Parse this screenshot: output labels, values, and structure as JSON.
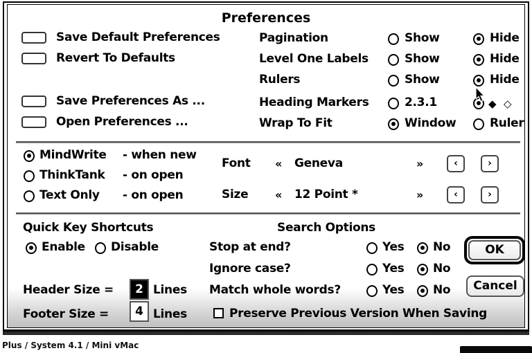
{
  "window": {
    "title": "Preferences"
  },
  "file_buttons": [
    {
      "label": "Save Default Preferences"
    },
    {
      "label": "Revert To Defaults"
    },
    {
      "label": "Save Preferences As ..."
    },
    {
      "label": "Open Preferences ..."
    }
  ],
  "display_options": [
    {
      "label": "Pagination",
      "option_a": "Show",
      "option_b": "Hide",
      "selected": "Hide"
    },
    {
      "label": "Level One Labels",
      "option_a": "Show",
      "option_b": "Hide",
      "selected": "Hide"
    },
    {
      "label": "Rulers",
      "option_a": "Show",
      "option_b": "Hide",
      "selected": "Hide"
    },
    {
      "label": "Heading Markers",
      "option_a": "2.3.1",
      "option_b": "",
      "marker_filled": "◆",
      "marker_hollow": "◇",
      "selected": "markers"
    },
    {
      "label": "Wrap To Fit",
      "option_a": "Window",
      "option_b": "Ruler",
      "selected": "Window"
    }
  ],
  "file_format": {
    "options": [
      {
        "name": "MindWrite",
        "when": "- when new",
        "selected": true
      },
      {
        "name": "ThinkTank",
        "when": "- on open",
        "selected": false
      },
      {
        "name": "Text Only",
        "when": "- on open",
        "selected": false
      }
    ]
  },
  "font_settings": {
    "font_label": "Font",
    "font_prev_chevron": "«",
    "font_value": "Geneva",
    "font_next_chevron": "»",
    "font_left_arrow": "‹",
    "font_right_arrow": "›",
    "size_label": "Size",
    "size_prev_chevron": "«",
    "size_value": "12 Point *",
    "size_next_chevron": "»",
    "size_left_arrow": "‹",
    "size_right_arrow": "›"
  },
  "quick_keys": {
    "heading": "Quick Key Shortcuts",
    "enable_label": "Enable",
    "disable_label": "Disable",
    "selected": "Enable"
  },
  "page_sizes": {
    "header_label": "Header Size =",
    "header_value": "2",
    "header_units": "Lines",
    "footer_label": "Footer Size =",
    "footer_value": "4",
    "footer_units": "Lines"
  },
  "search_options": {
    "heading": "Search Options",
    "yes_label": "Yes",
    "no_label": "No",
    "rows": [
      {
        "label": "Stop at end?",
        "selected": "No"
      },
      {
        "label": "Ignore case?",
        "selected": "No"
      },
      {
        "label": "Match whole words?",
        "selected": "No"
      }
    ],
    "preserve_label": "Preserve Previous Version When Saving",
    "preserve_checked": false
  },
  "actions": {
    "ok_label": "OK",
    "cancel_label": "Cancel"
  },
  "status": {
    "text": "Plus / System 4.1 / Mini vMac"
  }
}
